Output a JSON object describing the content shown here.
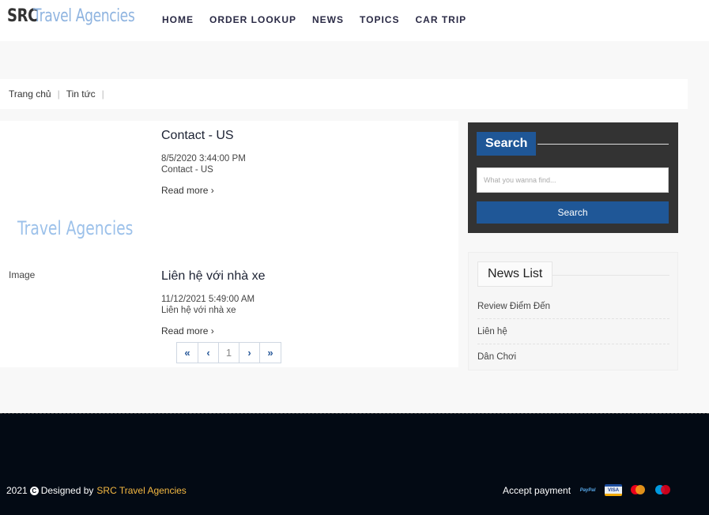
{
  "header": {
    "logo_part1": "SRC",
    "logo_part2": "Travel Agencies",
    "nav": [
      "HOME",
      "ORDER LOOKUP",
      "NEWS",
      "TOPICS",
      "CAR TRIP"
    ]
  },
  "breadcrumb": {
    "home": "Trang chủ",
    "current": "Tin tức",
    "separator": "|"
  },
  "posts": [
    {
      "thumb_logo": "Travel Agencies",
      "title": "Contact - US",
      "date": "8/5/2020 3:44:00 PM",
      "excerpt": "Contact - US",
      "more": "Read more ›"
    },
    {
      "thumb_alt": "Image",
      "title": "Liên hệ với nhà xe",
      "date": "11/12/2021 5:49:00 AM",
      "excerpt": "Liên hệ với nhà xe",
      "more": "Read more ›"
    }
  ],
  "pagination": {
    "first": "«",
    "prev": "‹",
    "page": "1",
    "next": "›",
    "last": "»"
  },
  "search": {
    "heading": "Search",
    "placeholder": "What you wanna find...",
    "button": "Search"
  },
  "news_list": {
    "heading": "News List",
    "items": [
      "Review Điểm Đến",
      "Liên hệ",
      "Dân Chơi"
    ]
  },
  "footer": {
    "year": "2021",
    "designed_by": "Designed by",
    "brand": "SRC Travel Agencies",
    "accept_payment": "Accept payment",
    "payment_icons": [
      "paypal-icon",
      "visa-icon",
      "mastercard-icon",
      "maestro-icon"
    ],
    "paypal_text": "PayPal",
    "visa_text": "VISA"
  },
  "colors": {
    "primary": "#1f5797",
    "footer_bg": "#030a14",
    "brand_accent": "#f5b942",
    "logo_blue": "#8fb4e0"
  }
}
